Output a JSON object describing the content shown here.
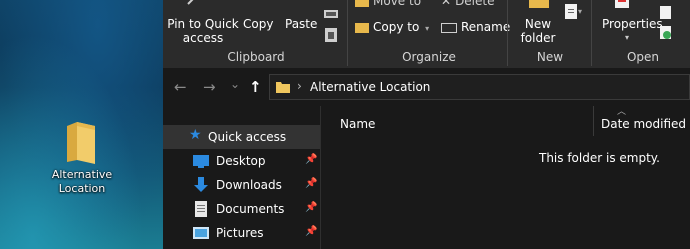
{
  "desktop": {
    "icon_label_line1": "Alternative",
    "icon_label_line2": "Location",
    "icon": "folder-icon"
  },
  "ribbon": {
    "clipboard": {
      "pin_label_1": "Pin to Quick",
      "pin_label_2": "access",
      "copy_label": "Copy",
      "paste_label": "Paste",
      "group_label": "Clipboard"
    },
    "organize": {
      "move_to_label": "Move to",
      "copy_to_label": "Copy to",
      "delete_label": "Delete",
      "rename_label": "Rename",
      "group_label": "Organize"
    },
    "new": {
      "new_folder_label_1": "New",
      "new_folder_label_2": "folder",
      "group_label": "New"
    },
    "open": {
      "properties_label": "Properties",
      "group_label": "Open"
    }
  },
  "address_bar": {
    "back": "←",
    "forward": "→",
    "recent": "⌄",
    "up": "↑",
    "separator": "›",
    "path": "Alternative Location"
  },
  "nav_pane": {
    "items": [
      {
        "label": "Quick access",
        "icon": "star-icon",
        "selected": true
      },
      {
        "label": "Desktop",
        "icon": "desktop-icon",
        "pinned": true
      },
      {
        "label": "Downloads",
        "icon": "download-icon",
        "pinned": true
      },
      {
        "label": "Documents",
        "icon": "document-icon",
        "pinned": true
      },
      {
        "label": "Pictures",
        "icon": "pictures-icon",
        "pinned": true
      }
    ]
  },
  "content": {
    "columns": [
      "Name",
      "Date modified"
    ],
    "empty_message": "This folder is empty."
  },
  "colors": {
    "ribbon_bg": "#2b2b2b",
    "window_bg": "#191919",
    "selected_bg": "#333333",
    "folder_yellow": "#f0c75e",
    "accent_blue": "#2b8ae0"
  }
}
